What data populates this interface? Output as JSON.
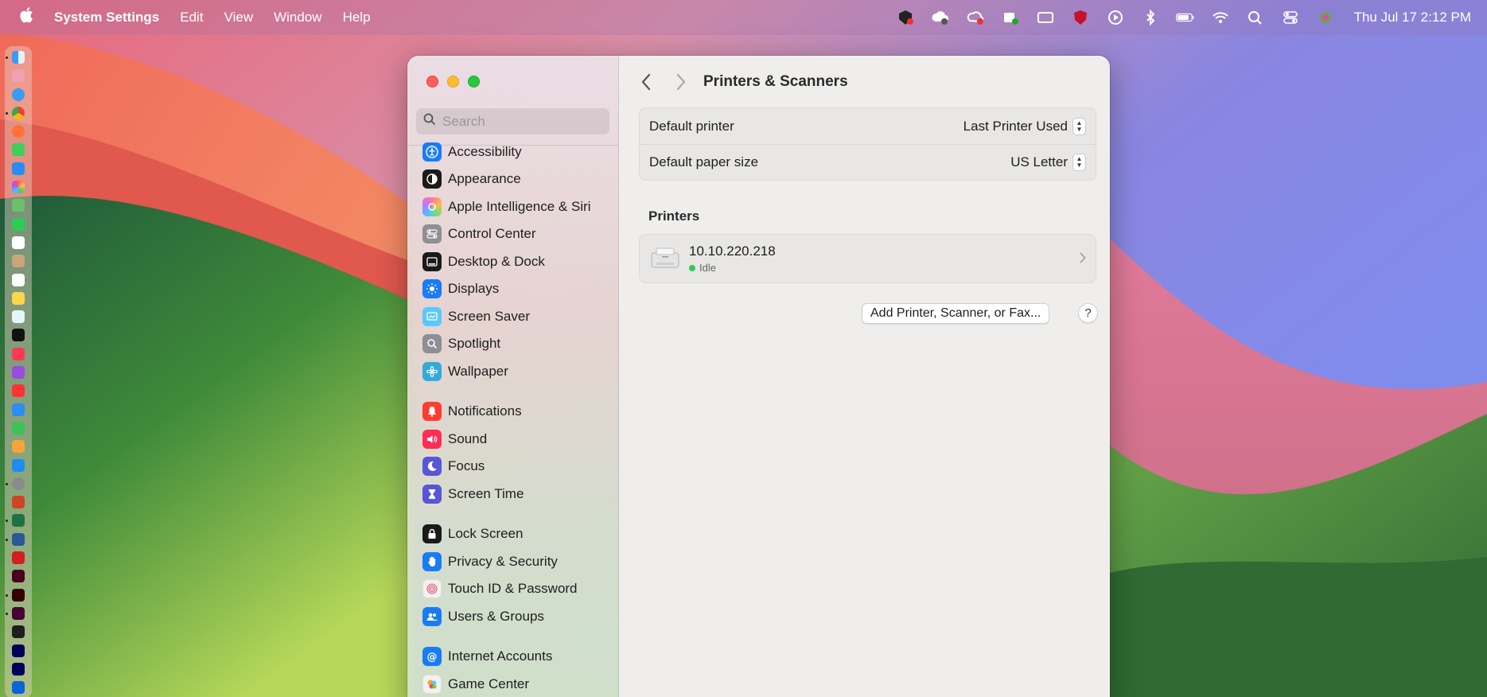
{
  "menubar": {
    "app_name": "System Settings",
    "menus": [
      "Edit",
      "View",
      "Window",
      "Help"
    ],
    "clock": "Thu Jul 17  2:12 PM",
    "status_icons": [
      "malwarebytes-icon",
      "cloud-sync-icon",
      "creative-cloud-icon",
      "teams-icon",
      "display-icon",
      "mcafee-icon",
      "play-icon",
      "bluetooth-icon",
      "battery-icon",
      "wifi-icon",
      "spotlight-icon",
      "control-center-icon",
      "siri-icon"
    ]
  },
  "window": {
    "search": {
      "placeholder": "Search"
    },
    "sidebar": {
      "items": [
        {
          "label": "Accessibility",
          "icon": "accessibility-icon",
          "color": "#1a7cf5"
        },
        {
          "label": "Appearance",
          "icon": "appearance-icon",
          "color": "#1a1a1a"
        },
        {
          "label": "Apple Intelligence & Siri",
          "icon": "siri-icon",
          "color": "#e07aa0"
        },
        {
          "label": "Control Center",
          "icon": "control-center-icon",
          "color": "#8e8e93"
        },
        {
          "label": "Desktop & Dock",
          "icon": "dock-icon",
          "color": "#1a1a1a"
        },
        {
          "label": "Displays",
          "icon": "displays-icon",
          "color": "#1a7cf5"
        },
        {
          "label": "Screen Saver",
          "icon": "screen-saver-icon",
          "color": "#5ac8fa"
        },
        {
          "label": "Spotlight",
          "icon": "spotlight-icon",
          "color": "#8e8e93"
        },
        {
          "label": "Wallpaper",
          "icon": "wallpaper-icon",
          "color": "#34aadc"
        },
        {
          "label": "Notifications",
          "icon": "bell-icon",
          "color": "#ff3b30"
        },
        {
          "label": "Sound",
          "icon": "sound-icon",
          "color": "#ff2d55"
        },
        {
          "label": "Focus",
          "icon": "moon-icon",
          "color": "#5856d6"
        },
        {
          "label": "Screen Time",
          "icon": "hourglass-icon",
          "color": "#5856d6"
        },
        {
          "label": "Lock Screen",
          "icon": "lock-icon",
          "color": "#1a1a1a"
        },
        {
          "label": "Privacy & Security",
          "icon": "hand-icon",
          "color": "#1a7cf5"
        },
        {
          "label": "Touch ID & Password",
          "icon": "fingerprint-icon",
          "color": "#f2f2f2"
        },
        {
          "label": "Users & Groups",
          "icon": "users-icon",
          "color": "#1a7cf5"
        },
        {
          "label": "Internet Accounts",
          "icon": "at-icon",
          "color": "#1a7cf5"
        },
        {
          "label": "Game Center",
          "icon": "game-center-icon",
          "color": "#f2f2f2"
        }
      ]
    },
    "main": {
      "title": "Printers & Scanners",
      "default_printer": {
        "label": "Default printer",
        "value": "Last Printer Used"
      },
      "default_paper": {
        "label": "Default paper size",
        "value": "US Letter"
      },
      "printers_section": "Printers",
      "printers": [
        {
          "name": "10.10.220.218",
          "status": "Idle"
        }
      ],
      "add_button": "Add Printer, Scanner, or Fax...",
      "help_button": "?"
    }
  }
}
